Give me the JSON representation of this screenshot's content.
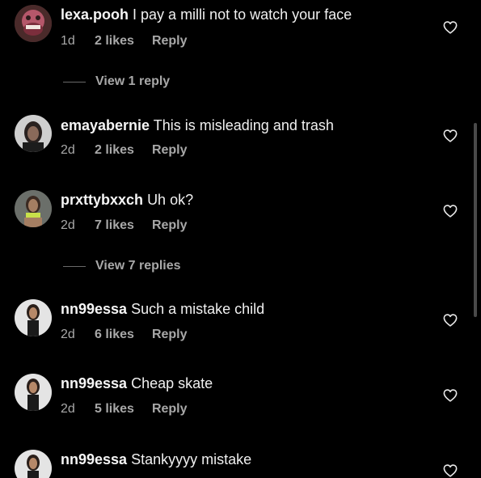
{
  "comments": [
    {
      "username": "lexa.pooh",
      "text": "I pay a milli not to watch your face",
      "time": "1d",
      "likes": "2 likes",
      "reply": "Reply"
    },
    {
      "username": "emayabernie",
      "text": "This is misleading and trash",
      "time": "2d",
      "likes": "2 likes",
      "reply": "Reply"
    },
    {
      "username": "prxttybxxch",
      "text": "Uh ok?",
      "time": "2d",
      "likes": "7 likes",
      "reply": "Reply"
    },
    {
      "username": "nn99essa",
      "text": "Such a mistake child",
      "time": "2d",
      "likes": "6 likes",
      "reply": "Reply"
    },
    {
      "username": "nn99essa",
      "text": "Cheap skate",
      "time": "2d",
      "likes": "5 likes",
      "reply": "Reply"
    },
    {
      "username": "nn99essa",
      "text": "Stankyyyy mistake"
    }
  ],
  "view_replies": [
    {
      "label": "View 1 reply"
    },
    {
      "label": "View 7 replies"
    }
  ],
  "colors": {
    "background": "#000000",
    "primary_text": "#f5f5f5",
    "secondary_text": "#a8a8a8"
  },
  "icons": {
    "like": "heart-outline-icon"
  }
}
